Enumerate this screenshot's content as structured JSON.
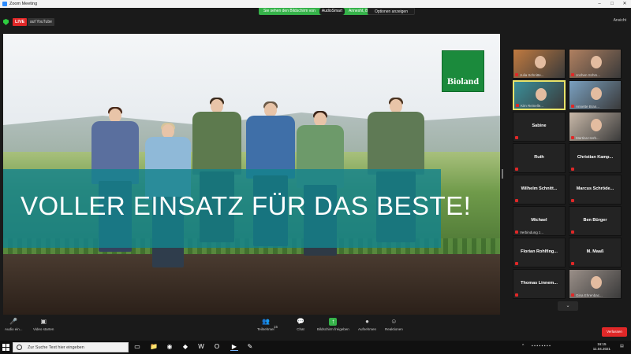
{
  "window": {
    "title": "Zoom Meeting"
  },
  "topbar": {
    "live_badge": "LIVE",
    "stream_target": "auf YouTube",
    "share_banner_text": "Sie sehen den Bildschirm von",
    "share_banner_pill": "AudioSmart",
    "share_banner_suffix": "Annesht, Boland",
    "share_options": "Optionen anzeigen",
    "view_label": "Ansicht"
  },
  "slide": {
    "headline": "VOLLER EINSATZ FÜR DAS BESTE!",
    "logo_text": "Bioland",
    "colors": {
      "banner": "#14828c",
      "logo": "#1b8a3c"
    }
  },
  "gallery": {
    "tiles": [
      {
        "name": "Julia Schnitte...",
        "video": true
      },
      {
        "name": "Jochen Schm...",
        "video": true
      },
      {
        "name": "Kim Reinelle...",
        "video": true,
        "active": true
      },
      {
        "name": "Annette Bran...",
        "video": true
      },
      {
        "name": "Sabine",
        "video": false
      },
      {
        "name": "Martina Herb...",
        "video": true
      },
      {
        "name": "Ruth",
        "video": false
      },
      {
        "name": "Christian Kamp...",
        "video": false
      },
      {
        "name": "Wilhelm Schnitt...",
        "video": false
      },
      {
        "name": "Marcus Schröde...",
        "video": false
      },
      {
        "name": "Michael",
        "video": false,
        "status": "Verbindung z..."
      },
      {
        "name": "Ben Bürger",
        "video": false
      },
      {
        "name": "Florian Rohlfing...",
        "video": false
      },
      {
        "name": "M. Maaß",
        "video": false
      },
      {
        "name": "Thomas Linnem...",
        "video": false
      },
      {
        "name": "Gina Ehrenbac...",
        "video": true
      }
    ]
  },
  "toolbar": {
    "audio": "Audio ein...",
    "video": "Video starten",
    "participants": "Teilnehmer",
    "participants_count": "15",
    "chat": "Chat",
    "share": "Bildschirm freigeben",
    "record": "Aufnehmen",
    "reactions": "Reaktionen",
    "leave": "Verlassen"
  },
  "taskbar": {
    "search_placeholder": "Zur Suche Text hier eingeben",
    "time": "16:15",
    "date": "11.04.2021"
  }
}
